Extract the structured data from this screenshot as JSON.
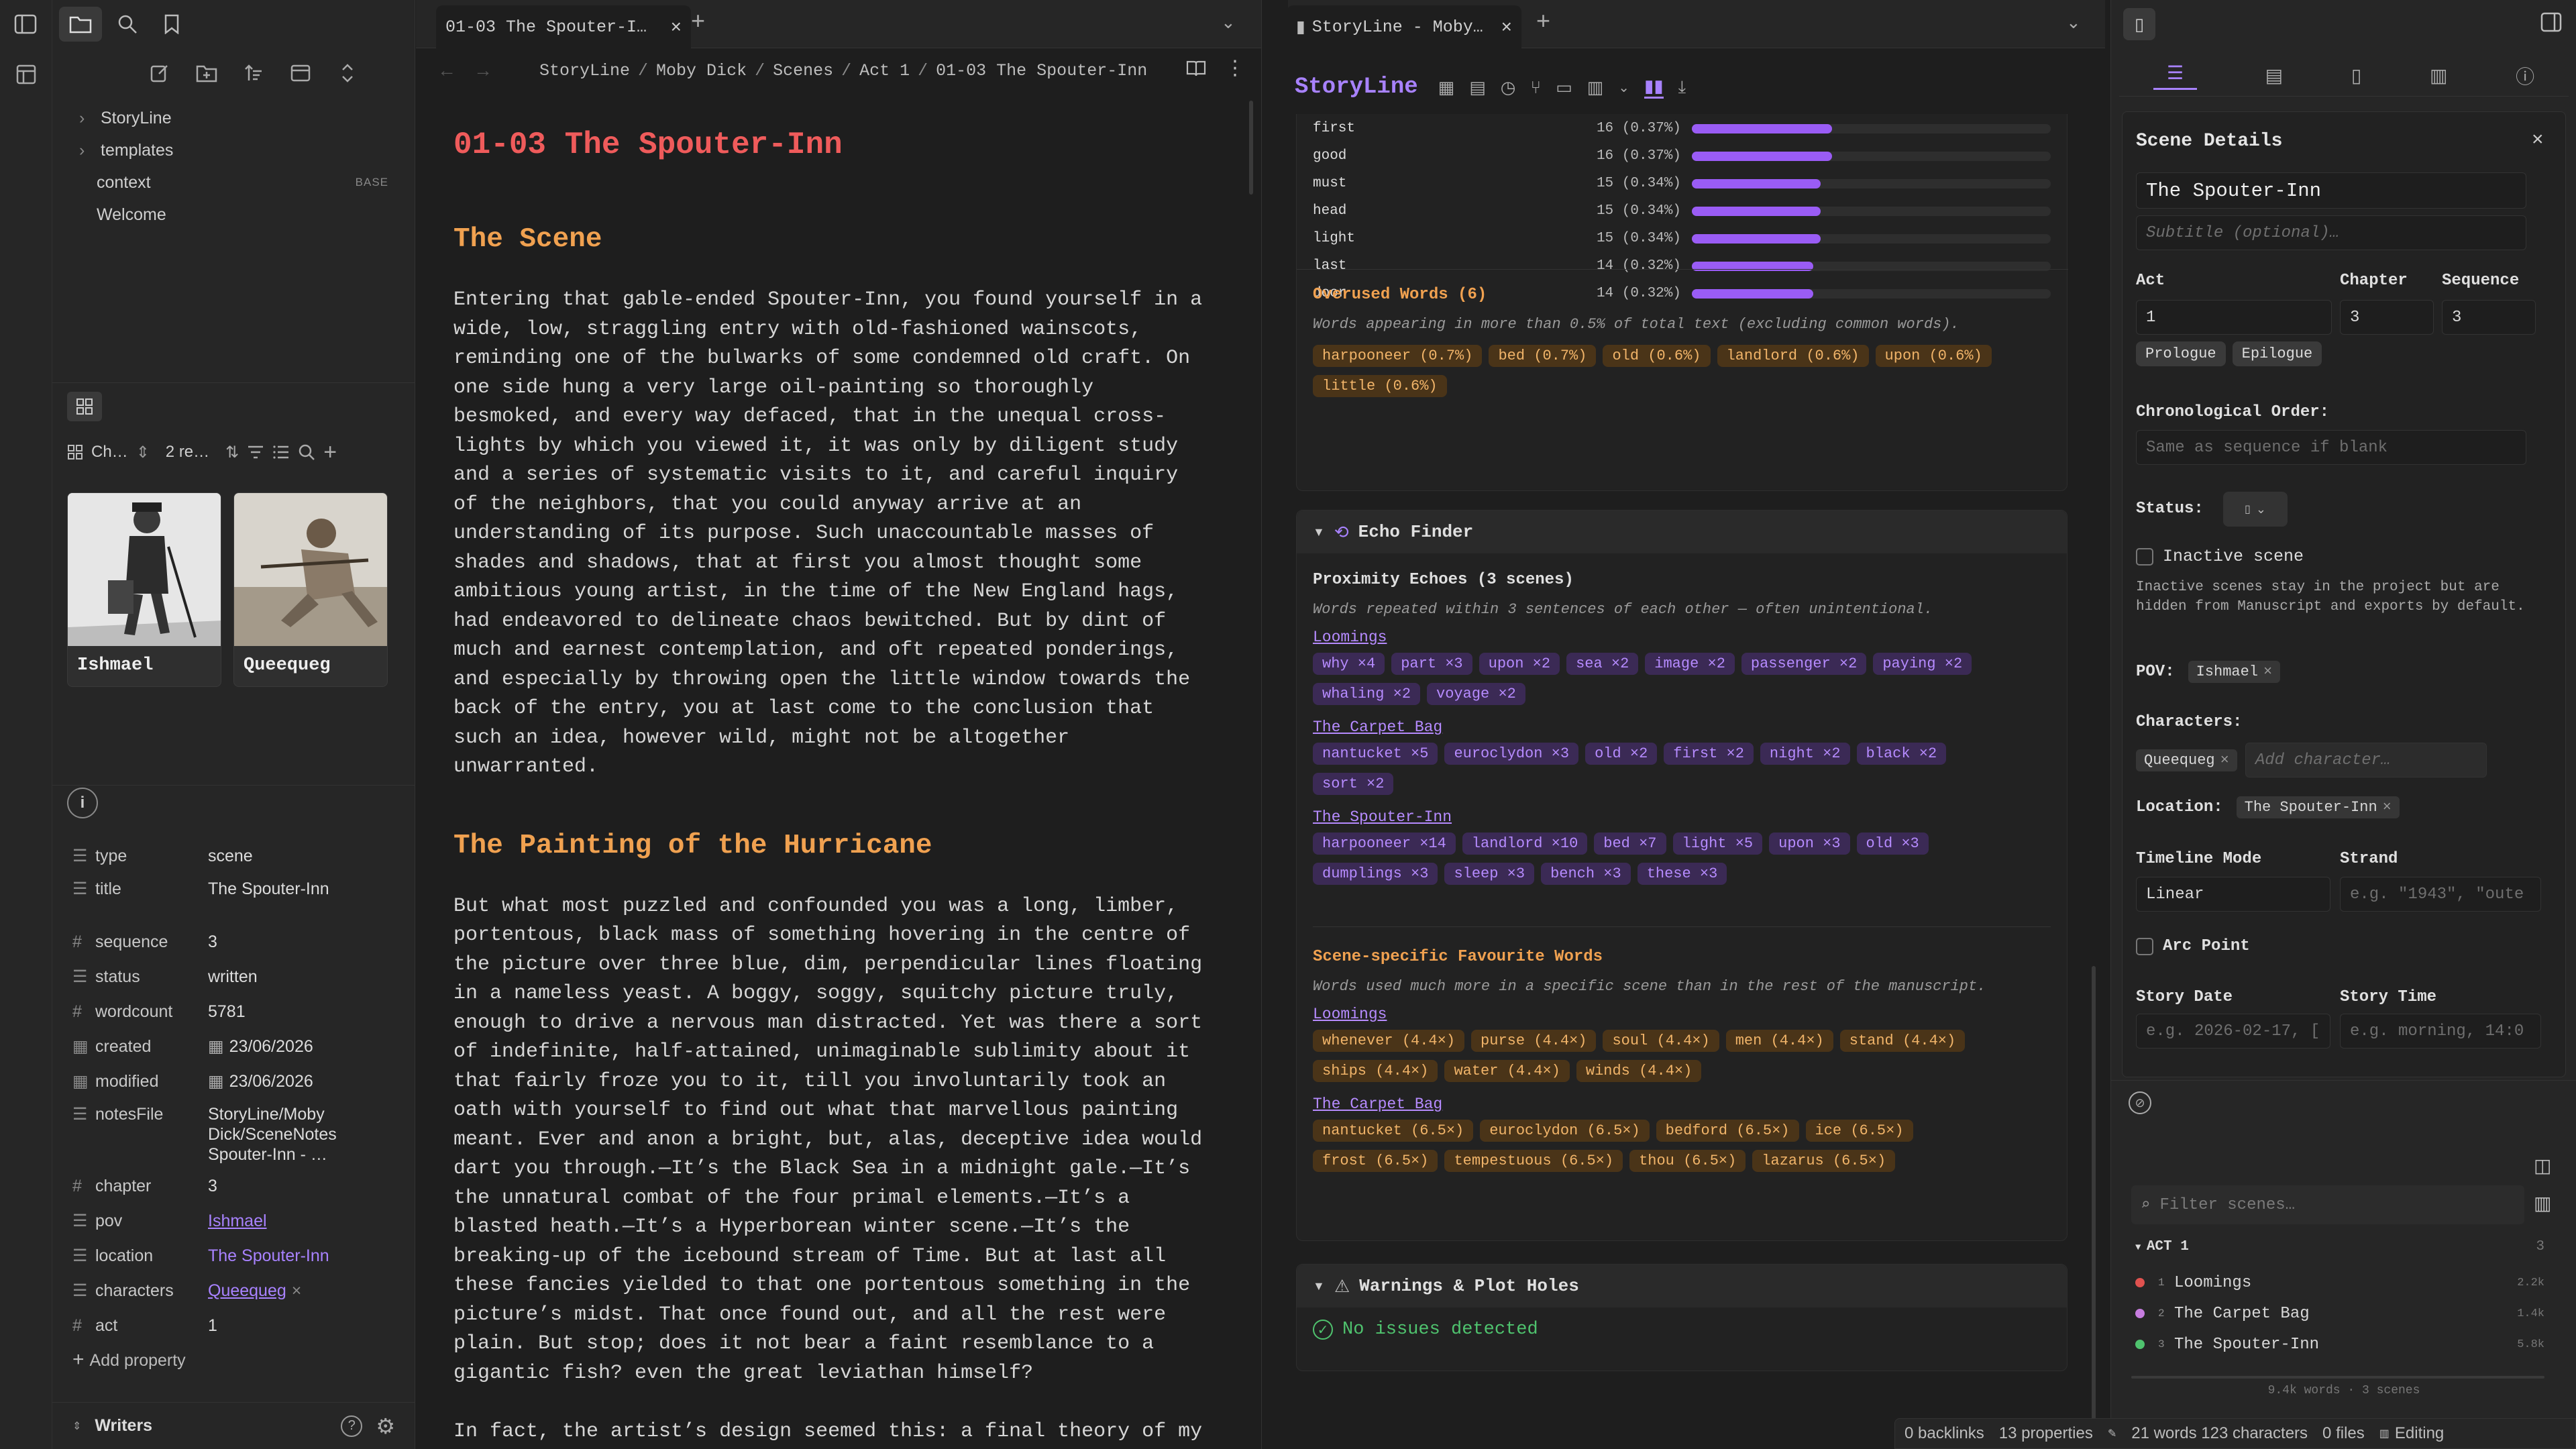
{
  "left_sidebar": {
    "tree": [
      {
        "label": "StoryLine",
        "folder": true
      },
      {
        "label": "templates",
        "folder": true
      },
      {
        "label": "context",
        "badge": "BASE"
      },
      {
        "label": "Welcome"
      }
    ],
    "view_toolbar": {
      "view_label": "Ch…",
      "count_label": "2 re…"
    },
    "cards": [
      {
        "name": "Ishmael"
      },
      {
        "name": "Queequeg"
      }
    ],
    "properties": [
      {
        "key": "type",
        "value": "scene",
        "icon": "list-icon"
      },
      {
        "key": "title",
        "value": "The Spouter-Inn",
        "icon": "list-icon"
      },
      {
        "key": "sequence",
        "value": "3",
        "icon": "number-icon"
      },
      {
        "key": "status",
        "value": "written",
        "icon": "list-icon"
      },
      {
        "key": "wordcount",
        "value": "5781",
        "icon": "number-icon"
      },
      {
        "key": "created",
        "value": "23/06/2026",
        "icon": "calendar-icon"
      },
      {
        "key": "modified",
        "value": "23/06/2026",
        "icon": "calendar-icon"
      },
      {
        "key": "notesFile",
        "value": "StoryLine/Moby Dick/SceneNotes Spouter-Inn - …",
        "icon": "list-icon"
      },
      {
        "key": "chapter",
        "value": "3",
        "icon": "number-icon"
      },
      {
        "key": "pov",
        "value": "Ishmael",
        "icon": "list-icon"
      },
      {
        "key": "location",
        "value": "The Spouter-Inn",
        "icon": "list-icon"
      },
      {
        "key": "characters",
        "value": "Queequeg",
        "icon": "list-icon"
      },
      {
        "key": "act",
        "value": "1",
        "icon": "number-icon"
      }
    ],
    "add_property": "Add property",
    "vault_name": "Writers"
  },
  "editor": {
    "tab_title": "01-03 The Spouter-I…",
    "breadcrumb": [
      "StoryLine",
      "Moby Dick",
      "Scenes",
      "Act 1",
      "01-03 The Spouter-Inn"
    ],
    "doc_title": "01-03 The Spouter-Inn",
    "h2_1": "The Scene",
    "para1_lines": [
      "Entering that gable-ended Spouter-Inn, you found yourself in a",
      "wide, low, straggling entry with old-fashioned wainscots,",
      "reminding one of the bulwarks of some condemned old craft. On",
      "one side hung a very large oil-painting so thoroughly",
      "besmoked, and every way defaced, that in the unequal cross-",
      "lights by which you viewed it, it was only by diligent study",
      "and a series of systematic visits to it, and careful inquiry",
      "of the neighbors, that you could anyway arrive at an",
      "understanding of its purpose. Such unaccountable masses of",
      "shades and shadows, that at first you almost thought some",
      "ambitious young artist, in the time of the New England hags,",
      "had endeavored to delineate chaos bewitched. But by dint of",
      "much and earnest contemplation, and oft repeated ponderings,",
      "and especially by throwing open the little window towards the",
      "back of the entry, you at last come to the conclusion that",
      "such an idea, however wild, might not be altogether",
      "unwarranted."
    ],
    "h2_2": "The Painting of the Hurricane",
    "para2_lines": [
      "But what most puzzled and confounded you was a long, limber,",
      "portentous, black mass of something hovering in the centre of",
      "the picture over three blue, dim, perpendicular lines floating",
      "in a nameless yeast. A boggy, soggy, squitchy picture truly,",
      "enough to drive a nervous man distracted. Yet was there a sort",
      "of indefinite, half-attained, unimaginable sublimity about it",
      "that fairly froze you to it, till you involuntarily took an",
      "oath with yourself to find out what that marvellous painting",
      "meant. Ever and anon a bright, but, alas, deceptive idea would",
      "dart you through.—It’s the Black Sea in a midnight gale.—It’s",
      "the unnatural combat of the four primal elements.—It’s a",
      "blasted heath.—It’s a Hyperborean winter scene.—It’s the",
      "breaking-up of the icebound stream of Time. But at last all",
      "these fancies yielded to that one portentous something in the",
      "picture’s midst. That once found out, and all the rest were",
      "plain. But stop; does it not bear a faint resemblance to a",
      "gigantic fish? even the great leviathan himself?"
    ],
    "para3_line": "In fact, the artist’s design seemed this: a final theory of my"
  },
  "storyline": {
    "tab_title": "StoryLine - Moby…",
    "heading": "StoryLine",
    "word_freq": [
      {
        "word": "first",
        "count": "16 (0.37%)",
        "pct": 0.37
      },
      {
        "word": "good",
        "count": "16 (0.37%)",
        "pct": 0.37
      },
      {
        "word": "must",
        "count": "15 (0.34%)",
        "pct": 0.34
      },
      {
        "word": "head",
        "count": "15 (0.34%)",
        "pct": 0.34
      },
      {
        "word": "light",
        "count": "15 (0.34%)",
        "pct": 0.34
      },
      {
        "word": "last",
        "count": "14 (0.32%)",
        "pct": 0.32
      },
      {
        "word": "door",
        "count": "14 (0.32%)",
        "pct": 0.32
      }
    ],
    "overused_title": "Overused Words (6)",
    "overused_desc": "Words appearing in more than 0.5% of total text (excluding common words).",
    "overused": [
      "harpooneer (0.7%)",
      "bed (0.7%)",
      "old (0.6%)",
      "landlord (0.6%)",
      "upon (0.6%)",
      "little (0.6%)"
    ],
    "echo_title": "Echo Finder",
    "prox_title": "Proximity Echoes (3 scenes)",
    "prox_desc": "Words repeated within 3 sentences of each other — often unintentional.",
    "prox": [
      {
        "scene": "Loomings",
        "chips": [
          "why ×4",
          "part ×3",
          "upon ×2",
          "sea ×2",
          "image ×2",
          "passenger ×2",
          "paying ×2",
          "whaling ×2",
          "voyage ×2"
        ]
      },
      {
        "scene": "The Carpet Bag",
        "chips": [
          "nantucket ×5",
          "euroclydon ×3",
          "old ×2",
          "first ×2",
          "night ×2",
          "black ×2",
          "sort ×2"
        ]
      },
      {
        "scene": "The Spouter-Inn",
        "chips": [
          "harpooneer ×14",
          "landlord ×10",
          "bed ×7",
          "light ×5",
          "upon ×3",
          "old ×3",
          "dumplings ×3",
          "sleep ×3",
          "bench ×3",
          "these ×3"
        ]
      }
    ],
    "fav_title": "Scene-specific Favourite Words",
    "fav_desc": "Words used much more in a specific scene than in the rest of the manuscript.",
    "fav": [
      {
        "scene": "Loomings",
        "chips": [
          "whenever (4.4×)",
          "purse (4.4×)",
          "soul (4.4×)",
          "men (4.4×)",
          "stand (4.4×)",
          "ships (4.4×)",
          "water (4.4×)",
          "winds (4.4×)"
        ]
      },
      {
        "scene": "The Carpet Bag",
        "chips": [
          "nantucket (6.5×)",
          "euroclydon (6.5×)",
          "bedford (6.5×)",
          "ice (6.5×)",
          "frost (6.5×)",
          "tempestuous (6.5×)",
          "thou (6.5×)",
          "lazarus (6.5×)"
        ]
      }
    ],
    "warn_title": "Warnings & Plot Holes",
    "warn_ok": "No issues detected"
  },
  "scene_details": {
    "title": "Scene Details",
    "scene_title": "The Spouter-Inn",
    "subtitle_ph": "Subtitle (optional)…",
    "act_label": "Act",
    "act": "1",
    "chapter_label": "Chapter",
    "chapter": "3",
    "sequence_label": "Sequence",
    "sequence": "3",
    "prologue": "Prologue",
    "epilogue": "Epilogue",
    "chrono_label": "Chronological Order:",
    "chrono_ph": "Same as sequence if blank",
    "status_label": "Status:",
    "inactive_label": "Inactive scene",
    "inactive_desc": "Inactive scenes stay in the project but are hidden from Manuscript and exports by default.",
    "pov_label": "POV:",
    "pov": "Ishmael",
    "chars_label": "Characters:",
    "char": "Queequeg",
    "add_char_ph": "Add character…",
    "loc_label": "Location:",
    "location": "The Spouter-Inn",
    "timeline_label": "Timeline Mode",
    "timeline": "Linear",
    "strand_label": "Strand",
    "strand_ph": "e.g. \"1943\", \"oute",
    "arc_label": "Arc Point",
    "date_label": "Story Date",
    "date_ph": "e.g. 2026-02-17, [",
    "time_label": "Story Time",
    "time_ph": "e.g. morning, 14:0"
  },
  "scene_list": {
    "filter_ph": "Filter scenes…",
    "act_label": "ACT 1",
    "act_count": "3",
    "scenes": [
      {
        "num": "1",
        "name": "Loomings",
        "words": "2.2k",
        "color": "#e0524f"
      },
      {
        "num": "2",
        "name": "The Carpet Bag",
        "words": "1.4k",
        "color": "#c77ddf"
      },
      {
        "num": "3",
        "name": "The Spouter-Inn",
        "words": "5.8k",
        "color": "#4fc36e"
      }
    ],
    "footer": "9.4k words · 3 scenes"
  },
  "status_bar": {
    "backlinks": "0 backlinks",
    "properties": "13 properties",
    "words": "21 words 123 characters",
    "files": "0 files",
    "mode": "Editing"
  },
  "colors": {
    "accent": "#a882ff",
    "orange_heading": "#f0a150",
    "title_red": "#ef5b5b"
  }
}
